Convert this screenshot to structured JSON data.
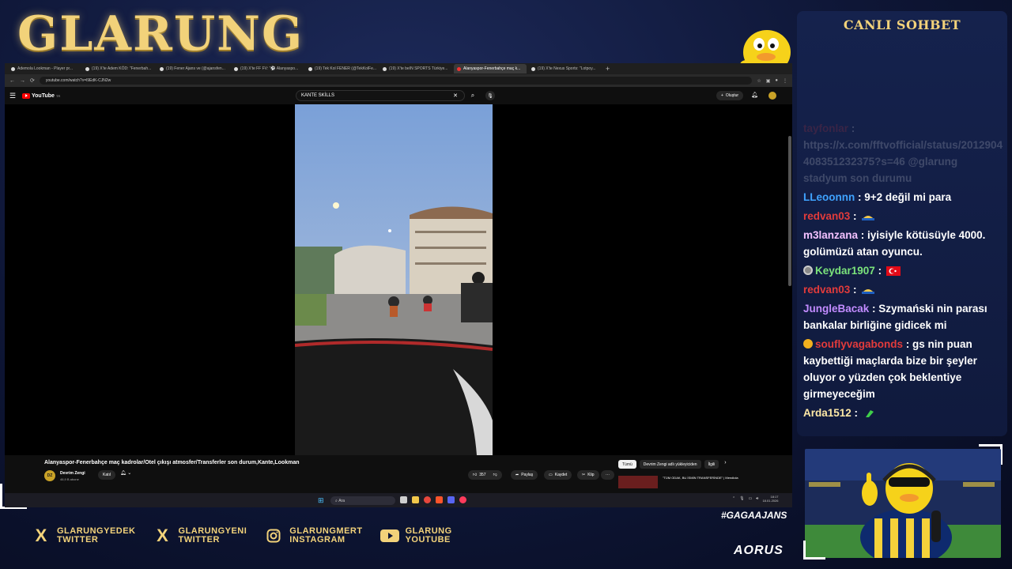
{
  "overlay": {
    "logo": "GLARUNG",
    "hashtag": "#GAGAAJANS",
    "sponsor": "AORUS",
    "socials": [
      {
        "icon": "x-icon",
        "line1": "GLARUNGYEDEK",
        "line2": "TWITTER"
      },
      {
        "icon": "x-icon",
        "line1": "GLARUNGYENI",
        "line2": "TWITTER"
      },
      {
        "icon": "instagram-icon",
        "line1": "GLARUNGMERT",
        "line2": "INSTAGRAM"
      },
      {
        "icon": "youtube-icon",
        "line1": "GLARUNG",
        "line2": "YOUTUBE"
      }
    ]
  },
  "browser": {
    "tabs": [
      {
        "label": "Ademola Lookman - Player pr...",
        "active": false
      },
      {
        "label": "(19) X'te Adem KÖD: \"Fenerbah...",
        "active": false
      },
      {
        "label": "(19) Fener Ajans ve (@ajansfen...",
        "active": false
      },
      {
        "label": "(19) X'te FF FV: \"⚽ Alanyaspo...",
        "active": false
      },
      {
        "label": "(19) Tek Kol FENER (@TekKolFe...",
        "active": false
      },
      {
        "label": "(19) X'te beIN SPORTS Türkiye...",
        "active": false
      },
      {
        "label": "Alanyaspor-Fenerbahçe maç k...",
        "active": true
      },
      {
        "label": "(19) X'te Nexus Sports: \"Lotpoy...",
        "active": false
      }
    ],
    "new_tab": "+",
    "url": "youtube.com/watch?v=l9EdK-CJN2w"
  },
  "youtube": {
    "brand": "YouTube",
    "brand_sup": "TR",
    "search_value": "KANTE SKİLLS",
    "create_label": "Oluştur",
    "video_title": "Alanyaspor-Fenerbahçe maç kadrolar/Otel çıkışı atmosfer/Transferler son durum,Kante,Lookman",
    "channel_initials": "DZ",
    "channel_name": "Devrim Zengi",
    "channel_subs": "46,9 B abone",
    "join_label": "Katıl",
    "like_count": "357",
    "share_label": "Paylaş",
    "save_label": "Kaydet",
    "clip_label": "Klip",
    "more_label": "···",
    "chips": [
      "Tümü",
      "Devrim Zengi adlı yükleyiciden",
      "İlgili"
    ],
    "rec_title": "\"TÜM ODAK, BU İSMİN TRANSFERİNDE\" | Mendiola"
  },
  "taskbar": {
    "search_placeholder": "Ara",
    "time": "18:17",
    "date": "18.01.2026"
  },
  "chat": {
    "title": "CANLI SOHBET",
    "messages": [
      {
        "user": "tayfonlar",
        "user_color": "#e23b3b",
        "text": "https://x.com/fftvofficial/status/2012904408351232375?s=46 @glarung stadyum son durumu",
        "faded": true
      },
      {
        "user": "LLeoonnn",
        "user_color": "#3fa3ff",
        "text": "9+2 değil mi para"
      },
      {
        "user": "redvan03",
        "user_color": "#e23b3b",
        "text": "",
        "emote": "hat-emote"
      },
      {
        "user": "m3lanzana",
        "user_color": "#f2c1ff",
        "text": "iyisiyle kötüsüyle 4000. golümüzü atan oyuncu."
      },
      {
        "user": "Keydar1907",
        "user_color": "#7be37b",
        "text": "",
        "badge": "globe-badge",
        "emote": "turkey-flag-emote"
      },
      {
        "user": "redvan03",
        "user_color": "#e23b3b",
        "text": "",
        "emote": "hat-emote"
      },
      {
        "user": "JungleBacak",
        "user_color": "#c28bff",
        "text": "Szymański nin parası bankalar birliğine gidicek mi"
      },
      {
        "user": "souflyvagabonds",
        "user_color": "#e23b3b",
        "text": "gs nin puan kaybettiği maçlarda bize bir şeyler oluyor o yüzden çok beklentiye girmeyeceğim",
        "badge": "gold-badge"
      },
      {
        "user": "Arda1512",
        "user_color": "#ffe9a6",
        "text": "",
        "emote": "green-emote"
      }
    ]
  },
  "colors": {
    "accent_gold": "#f2d27a",
    "bg_navy": "#0e1636",
    "youtube_red": "#ff0000"
  }
}
